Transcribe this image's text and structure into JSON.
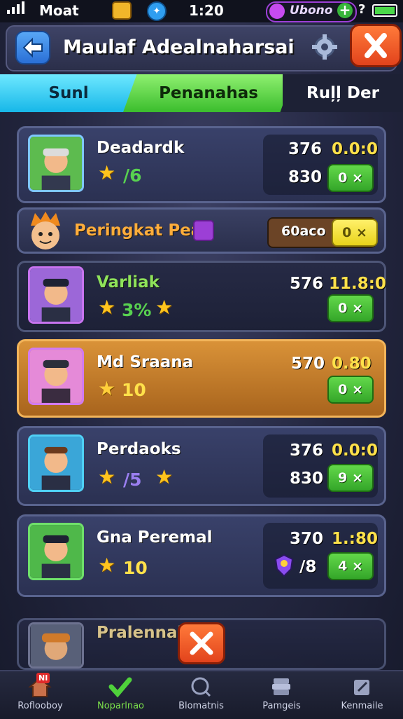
{
  "status_bar": {
    "carrier": "Moat",
    "time": "1:20",
    "pill_text": "Ubono"
  },
  "header": {
    "title": "Maulaf Adealnaharsai"
  },
  "tabs": [
    {
      "label": "Sunl",
      "state": "cyan"
    },
    {
      "label": "Penanahas",
      "state": "active"
    },
    {
      "label": "Ruļļ Der",
      "state": "inactive"
    }
  ],
  "leaderboard": [
    {
      "name": "Deadardk",
      "rank": "/6",
      "stat1": "376",
      "stat2": "830",
      "value": "0.0:0",
      "button": "0 ×"
    },
    {
      "name": "Peringkat Peat",
      "stat_box": "60aco",
      "button": "0 ×"
    },
    {
      "name": "Varliak",
      "rank": "3%",
      "stat1": "576",
      "value": "11.8:0",
      "button": "0 ×"
    },
    {
      "name": "Md Sraana",
      "rank": "10",
      "stat1": "570",
      "value": "0.80",
      "button": "0 ×"
    },
    {
      "name": "Perdaoks",
      "rank": "/5",
      "stat1": "376",
      "stat2": "830",
      "value": "0.0:0",
      "button": "9 ×"
    },
    {
      "name": "Gna Peremal",
      "rank": "10",
      "stat1": "370",
      "stat2": "/8",
      "value": "1.:80",
      "button": "4 ×"
    },
    {
      "name": "Pralennak"
    }
  ],
  "bottom_nav": [
    {
      "label": "Roflooboy",
      "badge": "NI"
    },
    {
      "label": "Noparlnao",
      "active": true
    },
    {
      "label": "Blomatnis"
    },
    {
      "label": "Pamgeis"
    },
    {
      "label": "Kenmaile"
    }
  ],
  "colors": {
    "accent_green": "#3bbd2d",
    "accent_cyan": "#17b7e8",
    "highlight_row": "#d99238",
    "close_red": "#e2431c"
  }
}
